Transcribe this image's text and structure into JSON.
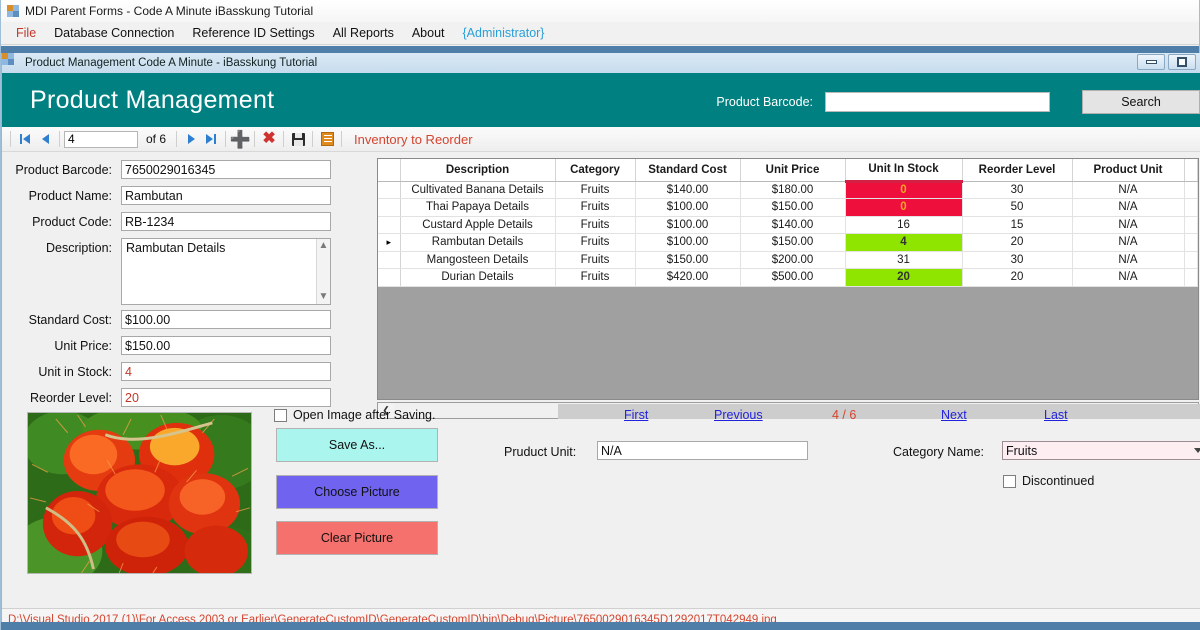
{
  "parent_window": {
    "title": "MDI Parent Forms - Code A Minute iBasskung Tutorial",
    "menu": [
      {
        "label": "File"
      },
      {
        "label": "Database Connection"
      },
      {
        "label": "Reference ID Settings"
      },
      {
        "label": "All Reports"
      },
      {
        "label": "About"
      },
      {
        "label": "{Administrator}"
      }
    ]
  },
  "child_window": {
    "title": "Product Management Code A Minute - iBasskung Tutorial",
    "minimize_label": "Minimize",
    "maximize_label": "Maximize"
  },
  "header": {
    "title": "Product  Management",
    "barcode_label": "Product Barcode:",
    "barcode_value": "",
    "barcode_placeholder": "",
    "search_label": "Search",
    "accent_color": "#008080"
  },
  "nav_toolbar": {
    "first_label": "First record",
    "previous_label": "Previous record",
    "position_value": "4",
    "of_label": "of 6",
    "next_label": "Next record",
    "last_label": "Last record",
    "add_label": "Add new",
    "delete_label": "Delete",
    "save_label": "Save data",
    "report_label": "Report",
    "inventory_link": "Inventory to Reorder",
    "inventory_color": "#d4452f"
  },
  "form": {
    "fields": [
      {
        "label": "Product Barcode:",
        "value": "7650029016345",
        "red": false
      },
      {
        "label": "Product Name:",
        "value": "Rambutan",
        "red": false
      },
      {
        "label": "Product Code:",
        "value": "RB-1234",
        "red": false
      }
    ],
    "description_label": "Description:",
    "description_value": "Rambutan Details",
    "fields2": [
      {
        "label": "Standard Cost:",
        "value": "$100.00",
        "red": false
      },
      {
        "label": "Unit Price:",
        "value": "$150.00",
        "red": false
      },
      {
        "label": "Unit in Stock:",
        "value": "4",
        "red": true
      },
      {
        "label": "Reorder Level:",
        "value": "20",
        "red": true
      }
    ]
  },
  "grid": {
    "columns": [
      "",
      "Description",
      "Category",
      "Standard Cost",
      "Unit Price",
      "Unit In Stock",
      "Reorder Level",
      "Product Unit",
      ""
    ],
    "rows": [
      {
        "marker": "",
        "description": "Cultivated Banana Details",
        "category": "Fruits",
        "standard_cost": "$140.00",
        "unit_price": "$180.00",
        "unit_in_stock": "0",
        "stock_state": "red",
        "reorder_level": "30",
        "product_unit": "N/A",
        "extra": ""
      },
      {
        "marker": "",
        "description": "Thai Papaya Details",
        "category": "Fruits",
        "standard_cost": "$100.00",
        "unit_price": "$150.00",
        "unit_in_stock": "0",
        "stock_state": "red",
        "reorder_level": "50",
        "product_unit": "N/A",
        "extra": ""
      },
      {
        "marker": "",
        "description": "Custard Apple Details",
        "category": "Fruits",
        "standard_cost": "$100.00",
        "unit_price": "$140.00",
        "unit_in_stock": "16",
        "stock_state": "none",
        "reorder_level": "15",
        "product_unit": "N/A",
        "extra": ""
      },
      {
        "marker": "▸",
        "description": "Rambutan Details",
        "category": "Fruits",
        "standard_cost": "$100.00",
        "unit_price": "$150.00",
        "unit_in_stock": "4",
        "stock_state": "green",
        "reorder_level": "20",
        "product_unit": "N/A",
        "extra": ""
      },
      {
        "marker": "",
        "description": "Mangosteen Details",
        "category": "Fruits",
        "standard_cost": "$150.00",
        "unit_price": "$200.00",
        "unit_in_stock": "31",
        "stock_state": "none",
        "reorder_level": "30",
        "product_unit": "N/A",
        "extra": ""
      },
      {
        "marker": "",
        "description": "Durian Details",
        "category": "Fruits",
        "standard_cost": "$420.00",
        "unit_price": "$500.00",
        "unit_in_stock": "20",
        "stock_state": "green",
        "reorder_level": "20",
        "product_unit": "N/A",
        "extra": ""
      }
    ],
    "colors": {
      "low_stock": "#ef0f3c",
      "ok_stock": "#8fe500",
      "header_underline": "#d12043"
    }
  },
  "bottom": {
    "open_image_label": "Open Image after Saving.",
    "open_image_checked": false,
    "save_as_label": "Save As...",
    "choose_picture_label": "Choose Picture",
    "clear_picture_label": "Clear Picture",
    "save_as_color": "#aaf5ee",
    "choose_picture_color": "#6f63ef",
    "clear_picture_color": "#f4716e",
    "links": {
      "first": "First",
      "previous": "Previous",
      "page_counter": "4 / 6",
      "next": "Next",
      "last": "Last"
    },
    "product_unit_label": "Pruduct Unit:",
    "product_unit_value": "N/A",
    "category_name_label": "Category Name:",
    "category_name_value": "Fruits",
    "discontinued_label": "Discontinued",
    "discontinued_checked": false
  },
  "statusbar": {
    "path": "D:\\Visual Studio 2017 (1)\\For Access 2003 or Earlier\\GenerateCustomID\\GenerateCustomID\\bin\\Debug\\Picture\\7650029016345D1292017T042949.jpg"
  }
}
